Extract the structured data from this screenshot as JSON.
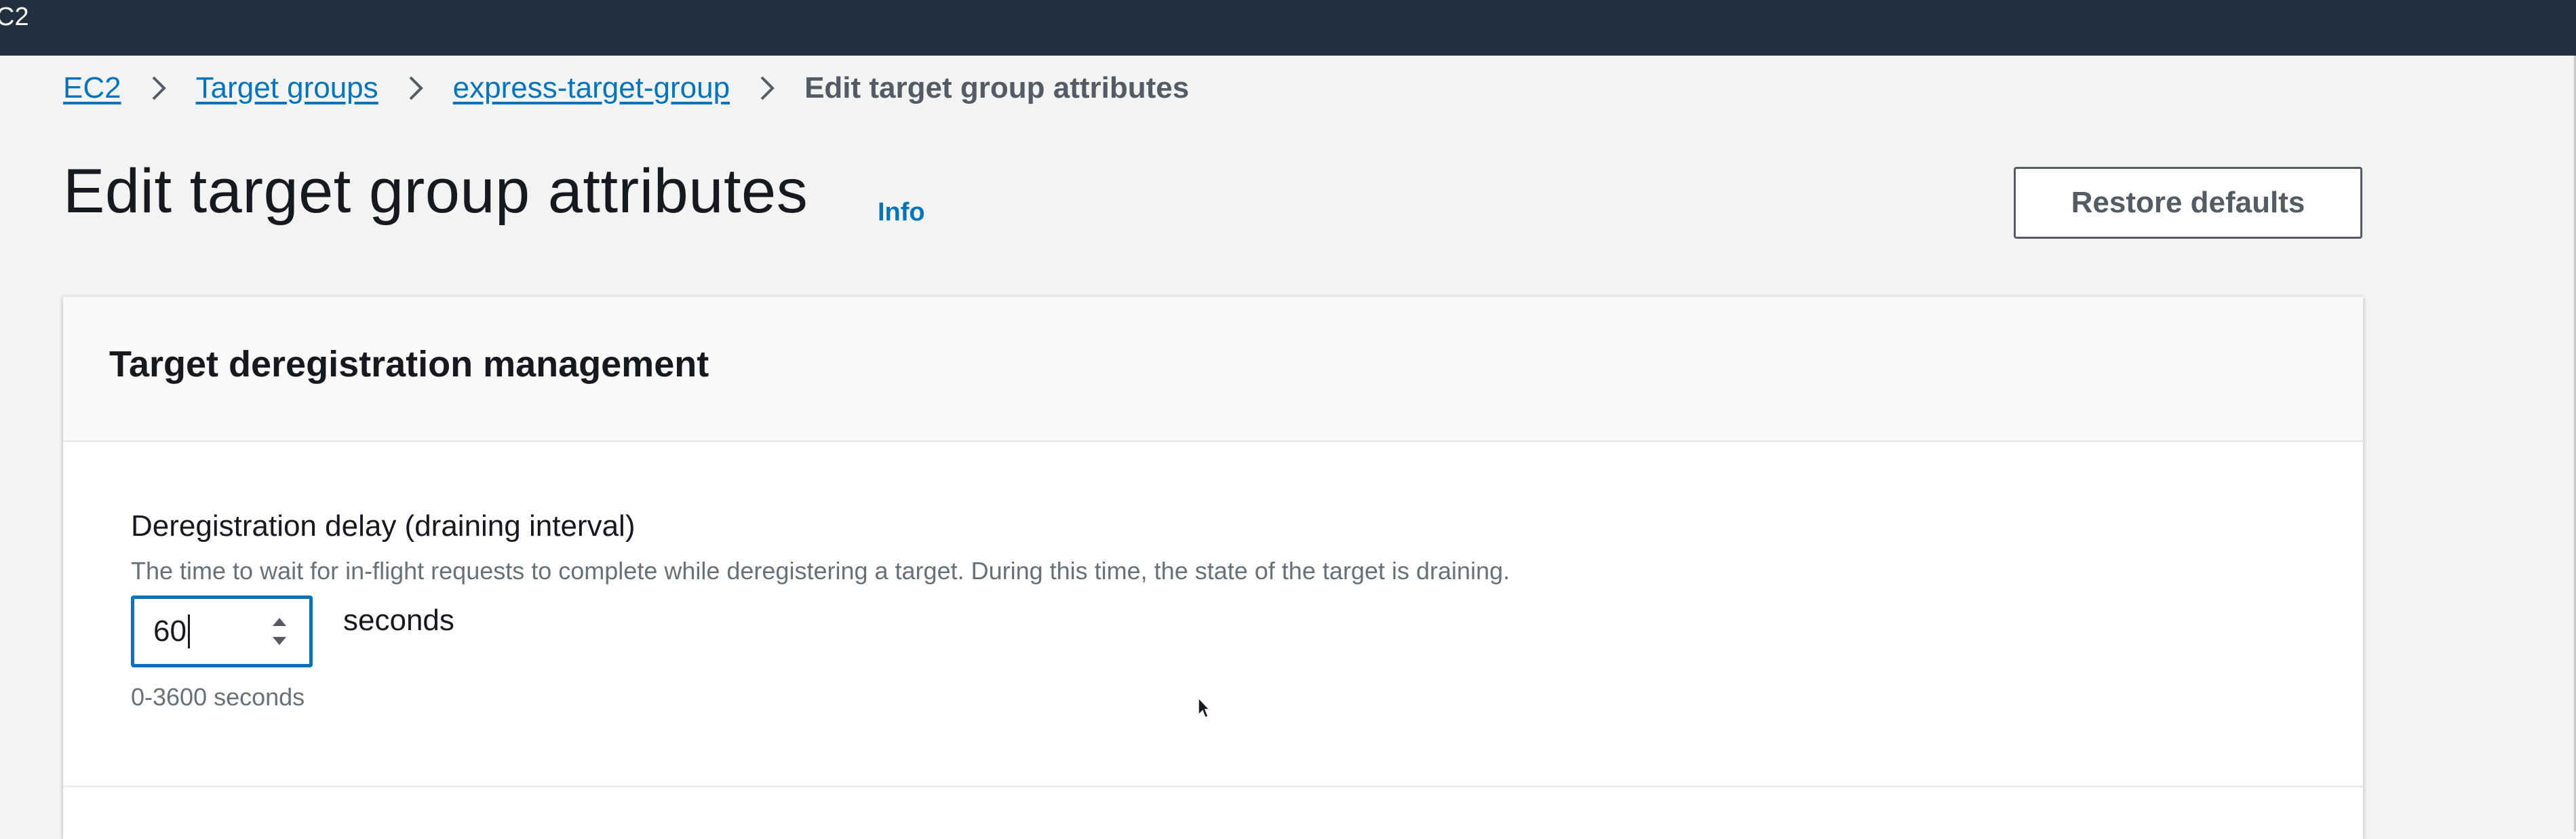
{
  "topbar": {
    "label": "C2"
  },
  "breadcrumb": {
    "items": [
      {
        "label": "EC2"
      },
      {
        "label": "Target groups"
      },
      {
        "label": "express-target-group"
      }
    ],
    "current": "Edit target group attributes"
  },
  "header": {
    "title": "Edit target group attributes",
    "info_label": "Info",
    "restore_button": "Restore defaults"
  },
  "panel": {
    "title": "Target deregistration management",
    "field": {
      "label": "Deregistration delay (draining interval)",
      "description": "The time to wait for in-flight requests to complete while deregistering a target. During this time, the state of the target is draining.",
      "value": "60",
      "unit": "seconds",
      "constraint": "0-3600 seconds"
    }
  },
  "colors": {
    "topbar": "#232f3e",
    "link": "#0073bb",
    "focus_border": "#0073bb",
    "background": "#f2f3f3"
  },
  "icons": [
    "chevron-right-icon",
    "stepper-up-icon",
    "stepper-down-icon",
    "mouse-cursor-icon"
  ]
}
